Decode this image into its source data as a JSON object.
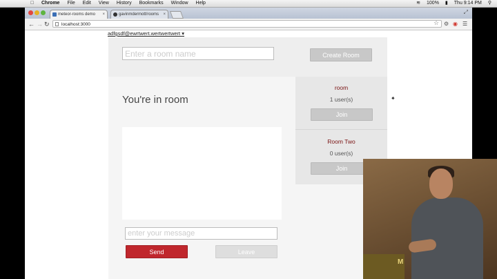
{
  "menubar": {
    "apple": "",
    "items": [
      "Chrome",
      "File",
      "Edit",
      "View",
      "History",
      "Bookmarks",
      "Window",
      "Help"
    ],
    "battery": "100%",
    "clock": "Thu 9:14 PM"
  },
  "browser": {
    "tabs": [
      {
        "title": "meteor-rooms demo",
        "active": true
      },
      {
        "title": "gavinmdermott/rooms",
        "active": false
      }
    ],
    "url": "localhost:3000"
  },
  "page": {
    "user": "adfgsdf@ewrtwert.wertwertwert ▾",
    "room_name_placeholder": "Enter a room name",
    "create_room_label": "Create Room",
    "status_heading": "You're in room",
    "message_placeholder": "enter your message",
    "send_label": "Send",
    "leave_label": "Leave",
    "rooms": [
      {
        "name": "room",
        "users": "1 user(s)",
        "join_label": "Join"
      },
      {
        "name": "Room Two",
        "users": "0 user(s)",
        "join_label": "Join"
      }
    ]
  },
  "video": {
    "sign_text": "M"
  },
  "colors": {
    "send_button": "#c0272d",
    "room_title": "#7a1313",
    "grey_button": "#c8c8c8"
  }
}
